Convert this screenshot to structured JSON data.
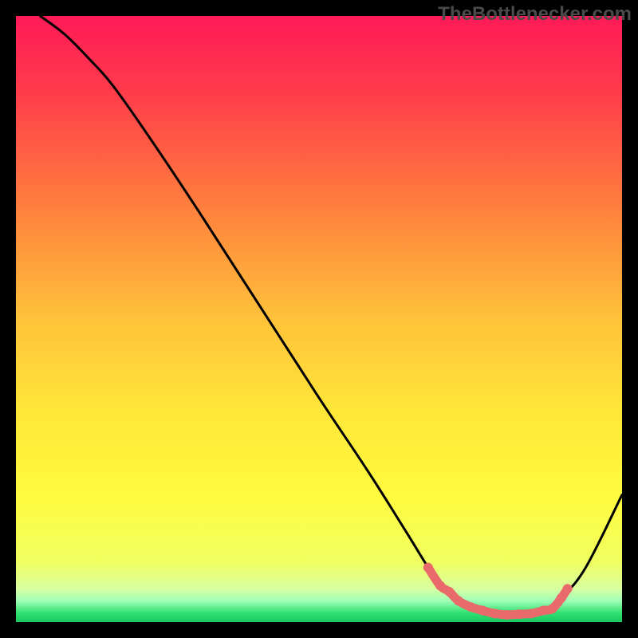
{
  "watermark": "TheBottlenecker.com",
  "chart_data": {
    "type": "line",
    "title": "",
    "xlabel": "",
    "ylabel": "",
    "xlim": [
      0,
      100
    ],
    "ylim": [
      0,
      100
    ],
    "gradient_stops": [
      {
        "offset": 0.0,
        "color": "#ff1a58"
      },
      {
        "offset": 0.12,
        "color": "#ff3a4b"
      },
      {
        "offset": 0.3,
        "color": "#ff7a3e"
      },
      {
        "offset": 0.5,
        "color": "#ffc23a"
      },
      {
        "offset": 0.65,
        "color": "#ffe638"
      },
      {
        "offset": 0.8,
        "color": "#fffc40"
      },
      {
        "offset": 0.9,
        "color": "#f0ff60"
      },
      {
        "offset": 0.945,
        "color": "#d8ffa0"
      },
      {
        "offset": 0.965,
        "color": "#9fffb6"
      },
      {
        "offset": 0.985,
        "color": "#30e070"
      },
      {
        "offset": 1.0,
        "color": "#18c860"
      }
    ],
    "series": [
      {
        "name": "curve",
        "stroke": "#000000",
        "x": [
          4,
          8,
          12,
          16,
          22,
          30,
          40,
          50,
          58,
          64,
          68,
          70,
          73,
          76,
          79,
          82,
          85,
          88,
          90,
          94,
          100
        ],
        "y": [
          100,
          97,
          93,
          88.5,
          80,
          68,
          52.5,
          37,
          25,
          15.5,
          9,
          6,
          3.5,
          2,
          1.4,
          1.2,
          1.4,
          2.2,
          4,
          9,
          21
        ]
      },
      {
        "name": "valley-dots",
        "stroke": "#e86a6a",
        "fill": "#e86a6a",
        "x": [
          68,
          70,
          71.5,
          73,
          75,
          77,
          79,
          81,
          83,
          85,
          87,
          88.5,
          90,
          91
        ],
        "y": [
          9,
          6,
          5,
          3.5,
          2.5,
          1.9,
          1.4,
          1.2,
          1.3,
          1.4,
          1.9,
          2.2,
          4,
          5.5
        ]
      }
    ]
  }
}
